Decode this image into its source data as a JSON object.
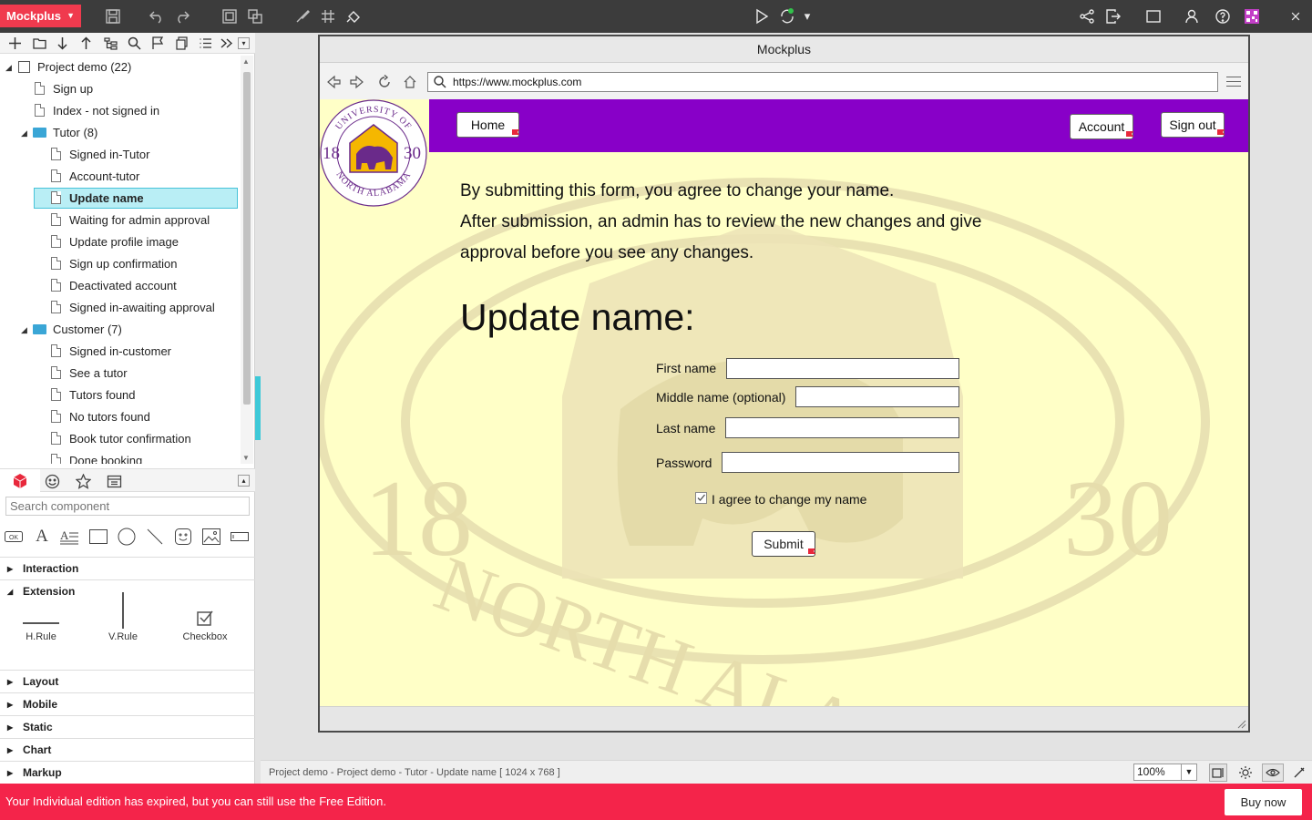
{
  "app": {
    "brand": "Mockplus",
    "colors": {
      "brand": "#f03a4e",
      "toolbar": "#3c3c3c",
      "selection": "#b9eef5",
      "accent": "#3ec9d8",
      "banner": "#f4244a",
      "page_nav": "#8800c8",
      "page_bg": "#ffffc7"
    }
  },
  "tree": {
    "project": "Project demo (22)",
    "items": [
      {
        "label": "Sign up"
      },
      {
        "label": "Index - not signed in"
      },
      {
        "label": "Tutor (8)"
      },
      {
        "label": "Signed in-Tutor"
      },
      {
        "label": "Account-tutor"
      },
      {
        "label": "Update name"
      },
      {
        "label": "Waiting for admin approval"
      },
      {
        "label": "Update profile image"
      },
      {
        "label": "Sign up confirmation"
      },
      {
        "label": "Deactivated account"
      },
      {
        "label": "Signed in-awaiting approval"
      },
      {
        "label": "Customer (7)"
      },
      {
        "label": "Signed in-customer"
      },
      {
        "label": "See a tutor"
      },
      {
        "label": "Tutors found"
      },
      {
        "label": "No tutors found"
      },
      {
        "label": "Book tutor confirmation"
      },
      {
        "label": "Done booking"
      }
    ]
  },
  "library": {
    "search_placeholder": "Search component",
    "sections": [
      "Interaction",
      "Extension",
      "Layout",
      "Mobile",
      "Static",
      "Chart",
      "Markup"
    ],
    "extension_items": [
      "H.Rule",
      "V.Rule",
      "Checkbox"
    ]
  },
  "preview": {
    "window_title": "Mockplus",
    "url": "https://www.mockplus.com",
    "nav": {
      "home": "Home",
      "account": "Account",
      "signout": "Sign out"
    },
    "seal": {
      "top": "UNIVERSITY OF",
      "bottom": "NORTH ALABAMA",
      "left_num": "18",
      "right_num": "30"
    },
    "intro": [
      "By submitting this form, you agree to change your name.",
      "After submission, an admin has to review the new changes and give",
      "approval before you see any changes."
    ],
    "heading": "Update name:",
    "form": {
      "first_name": "First name",
      "middle_name": "Middle name (optional)",
      "last_name": "Last name",
      "password": "Password",
      "agree": "I agree to change my name",
      "submit": "Submit"
    }
  },
  "status": {
    "breadcrumb": "Project demo - Project demo - Tutor - Update name [ 1024 x 768 ]",
    "zoom": "100%"
  },
  "banner": {
    "message": "Your Individual edition has expired, but you can still use the Free Edition.",
    "buy": "Buy now"
  }
}
